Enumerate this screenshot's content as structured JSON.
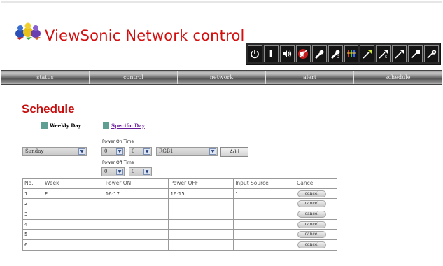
{
  "header": {
    "title": "ViewSonic Network control",
    "logo_icon": "viewsonic-birds-logo-icon",
    "toolbar_icons": [
      "power-standby-icon",
      "power-on-icon",
      "volume-icon",
      "mute-icon",
      "input-av-icon",
      "input-s-video-icon",
      "input-component-icon",
      "input-dvi-icon",
      "input-s-icon",
      "input-rgb-icon",
      "input-hdmi-icon",
      "input-dtv-icon"
    ]
  },
  "nav": {
    "tabs": [
      "status",
      "control",
      "network",
      "alert",
      "schedule"
    ]
  },
  "page": {
    "title": "Schedule",
    "legend_weekly": "Weekly Day",
    "legend_specific": "Specific Day",
    "power_on_label": "Power On Time",
    "power_off_label": "Power Off Time"
  },
  "form": {
    "day": "Sunday",
    "on_hour": "0",
    "on_min": "0",
    "input_source": "RGB1",
    "add_label": "Add",
    "off_hour": "0",
    "off_min": "0",
    "colon": ":"
  },
  "table": {
    "headers": [
      "No.",
      "Week",
      "Power ON",
      "Power OFF",
      "Input Source",
      "Cancel"
    ],
    "cancel_label": "cancel",
    "rows": [
      {
        "no": "1",
        "week": "Fri",
        "on": "16:17",
        "off": "16:15",
        "input": "1"
      },
      {
        "no": "2",
        "week": "",
        "on": "",
        "off": "",
        "input": ""
      },
      {
        "no": "3",
        "week": "",
        "on": "",
        "off": "",
        "input": ""
      },
      {
        "no": "4",
        "week": "",
        "on": "",
        "off": "",
        "input": ""
      },
      {
        "no": "5",
        "week": "",
        "on": "",
        "off": "",
        "input": ""
      },
      {
        "no": "6",
        "week": "",
        "on": "",
        "off": "",
        "input": ""
      }
    ]
  },
  "colors": {
    "title": "#d40f0f",
    "page_title": "#c80d0d",
    "legend_swatch": "#5f9e92",
    "specific_link": "#6a1b9a",
    "toolbar_bg": "#2a2a2a"
  }
}
